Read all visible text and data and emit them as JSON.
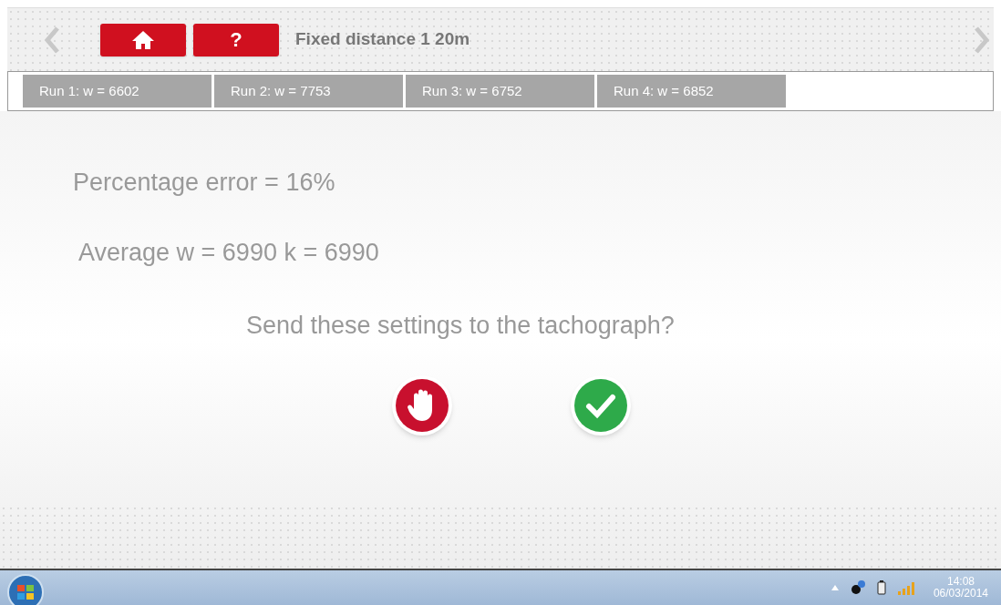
{
  "header": {
    "title": "Fixed distance 1 20m",
    "help_label": "?"
  },
  "runs": [
    {
      "label": "Run 1: w = 6602"
    },
    {
      "label": "Run 2: w = 7753"
    },
    {
      "label": "Run 3: w = 6752"
    },
    {
      "label": "Run 4: w = 6852"
    }
  ],
  "percentage_error": "Percentage error = 16%",
  "average": "Average w = 6990 k = 6990",
  "question": "Send these settings to the tachograph?",
  "taskbar": {
    "time": "14:08",
    "date": "06/03/2014"
  }
}
